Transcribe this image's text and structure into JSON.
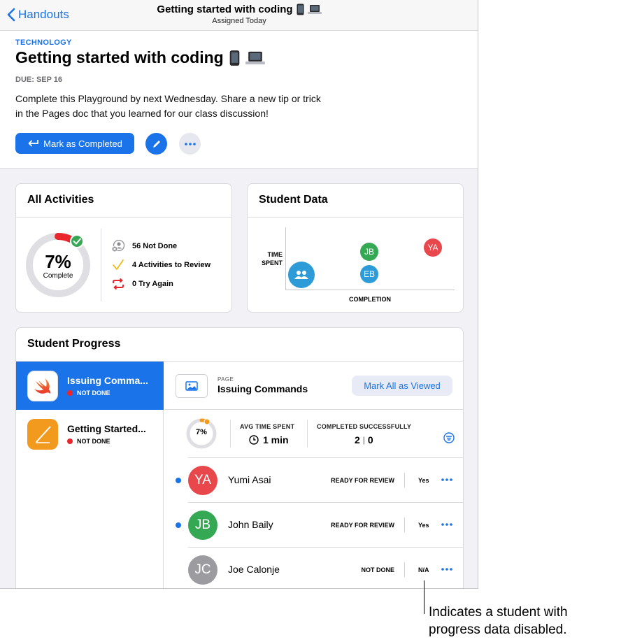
{
  "nav": {
    "back_label": "Handouts",
    "title": "Getting started with coding",
    "subtitle": "Assigned Today"
  },
  "assignment": {
    "category": "TECHNOLOGY",
    "title": "Getting started with coding",
    "due": "DUE: SEP 16",
    "description": "Complete this Playground by next Wednesday. Share a new tip or trick in the Pages doc that you learned for our class discussion!",
    "mark_completed_label": "Mark as Completed"
  },
  "all_activities": {
    "title": "All Activities",
    "percent": "7%",
    "percent_label": "Complete",
    "progress_fraction": 0.07,
    "stats": [
      {
        "icon": "person-x-icon",
        "label": "56 Not Done"
      },
      {
        "icon": "checkmark-icon",
        "label": "4 Activities to Review"
      },
      {
        "icon": "try-again-icon",
        "label": "0 Try Again"
      }
    ]
  },
  "student_data": {
    "title": "Student Data",
    "y_label_line1": "TIME",
    "y_label_line2": "SPENT",
    "x_label": "COMPLETION",
    "points": [
      {
        "initials": "JB",
        "color": "#34a853"
      },
      {
        "initials": "YA",
        "color": "#e8474c"
      },
      {
        "initials": "EB",
        "color": "#2d9bd8"
      }
    ]
  },
  "student_progress": {
    "title": "Student Progress",
    "activities": [
      {
        "name": "Issuing Comma...",
        "status": "NOT DONE",
        "active": true
      },
      {
        "name": "Getting Started...",
        "status": "NOT DONE",
        "active": false
      }
    ],
    "page": {
      "eyebrow": "PAGE",
      "name": "Issuing Commands",
      "mark_viewed_label": "Mark All as Viewed"
    },
    "summary": {
      "percent": "7%",
      "progress_fraction": 0.07,
      "avg_time_label": "AVG TIME SPENT",
      "avg_time_value": "1 min",
      "completed_label": "COMPLETED SUCCESSFULLY",
      "completed_value_a": "2",
      "completed_value_b": "0"
    },
    "students": [
      {
        "initials": "YA",
        "name": "Yumi Asai",
        "status": "READY FOR REVIEW",
        "value": "Yes",
        "color": "#e8474c",
        "unread": true
      },
      {
        "initials": "JB",
        "name": "John Baily",
        "status": "READY FOR REVIEW",
        "value": "Yes",
        "color": "#34a853",
        "unread": true
      },
      {
        "initials": "JC",
        "name": "Joe Calonje",
        "status": "NOT DONE",
        "value": "N/A",
        "color": "#9b9ba0",
        "unread": false
      }
    ]
  },
  "callout": {
    "line1": "Indicates a student with",
    "line2": "progress data disabled."
  }
}
